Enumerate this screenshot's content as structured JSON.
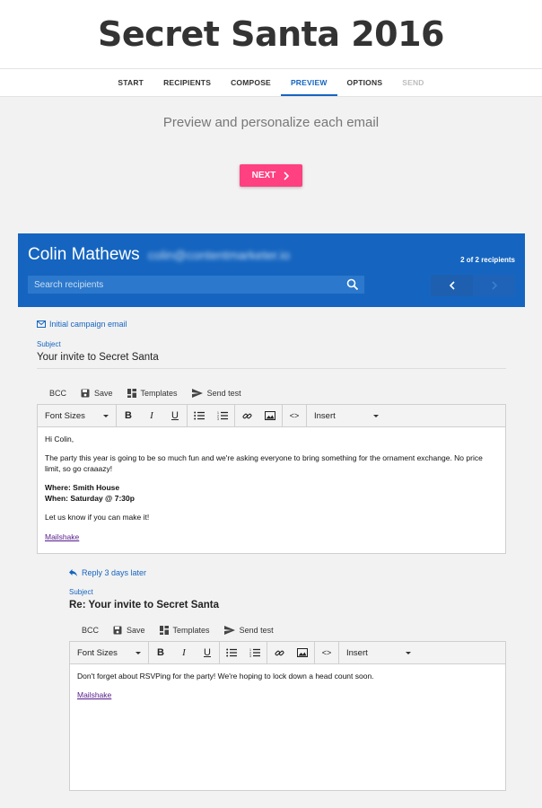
{
  "app": {
    "title": "Secret Santa 2016"
  },
  "nav": {
    "tabs": [
      "START",
      "RECIPIENTS",
      "COMPOSE",
      "PREVIEW",
      "OPTIONS",
      "SEND"
    ]
  },
  "page": {
    "subtitle": "Preview and personalize each email",
    "next_label": "NEXT"
  },
  "recipient": {
    "name": "Colin Mathews",
    "email": "colin@contentmarketer.io",
    "count_text": "2 of 2 recipients",
    "search_placeholder": "Search recipients"
  },
  "email": {
    "campaign_label": "Initial campaign email",
    "subject_label": "Subject",
    "subject": "Your invite to Secret Santa",
    "actions": {
      "bcc": "BCC",
      "save": "Save",
      "templates": "Templates",
      "send_test": "Send test"
    },
    "toolbar": {
      "font_sizes": "Font Sizes",
      "insert": "Insert",
      "bold": "B",
      "italic": "I",
      "underline": "U",
      "code": "<>"
    },
    "body": {
      "greeting": "Hi Colin,",
      "paragraph": "The party this year is going to be so much fun and we're asking everyone to bring something for the ornament exchange. No price limit, so go craaazy!",
      "where": "Where: Smith House",
      "when": "When: Saturday @ 7:30p",
      "closing": "Let us know if you can make it!",
      "link": "Mailshake"
    }
  },
  "reply": {
    "label": "Reply 3 days later",
    "subject_label": "Subject",
    "subject": "Re: Your invite to Secret Santa",
    "actions": {
      "bcc": "BCC",
      "save": "Save",
      "templates": "Templates",
      "send_test": "Send test"
    },
    "toolbar": {
      "font_sizes": "Font Sizes",
      "insert": "Insert",
      "bold": "B",
      "italic": "I",
      "underline": "U",
      "code": "<>"
    },
    "body": {
      "text": "Don't forget about RSVPing for the party! We're hoping to lock down a head count soon.",
      "link": "Mailshake"
    }
  },
  "colors": {
    "primary": "#1565c0",
    "accent": "#ff4081",
    "background": "#f2f2f2"
  }
}
